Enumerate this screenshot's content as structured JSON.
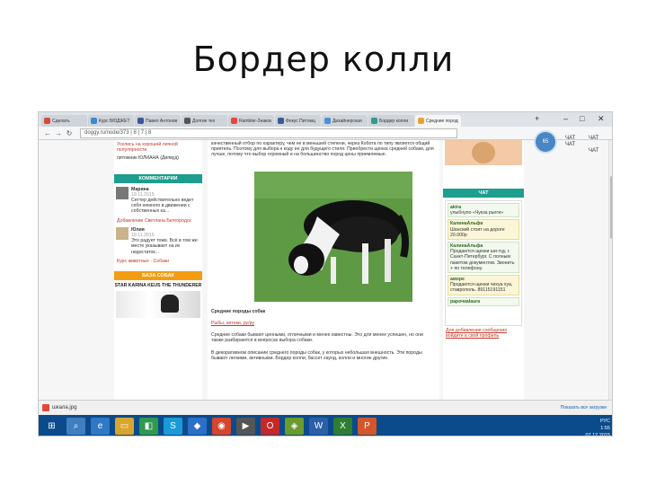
{
  "slide": {
    "title": "Бордер колли"
  },
  "browser": {
    "tabs": [
      {
        "label": "Сделать",
        "color": "#d64a3b",
        "active": false
      },
      {
        "label": "Курс БЮДЖЕТ",
        "color": "#3a8ad6",
        "active": false
      },
      {
        "label": "Павел Антонов",
        "color": "#3b5998",
        "active": false
      },
      {
        "label": "Долгие тех",
        "color": "#555555",
        "active": false
      },
      {
        "label": "Rambler-Знаком",
        "color": "#e8453c",
        "active": false
      },
      {
        "label": "Фокус Питомц",
        "color": "#3b5998",
        "active": false
      },
      {
        "label": "Дизайнерская",
        "color": "#4a90d9",
        "active": false
      },
      {
        "label": "Бордер колли",
        "color": "#2e9c8a",
        "active": false
      },
      {
        "label": "Средние породы",
        "color": "#f0a030",
        "active": true
      }
    ],
    "url": "doggy.ru/node/373 | 8 | 7 | 8",
    "extension": {
      "badge": "65",
      "labels": [
        "ЧАТ",
        "ЧАТ",
        "ЧАТ",
        "ЧАТ"
      ]
    }
  },
  "left_column": {
    "top_link": "Уселись на хорошей личной популярности",
    "top_author": "питомник ЮЛИАНА (Дипвуд)",
    "comments_title": "КОММЕНТАРИИ",
    "comments": [
      {
        "name": "Марина",
        "date": "19.11.2015",
        "text": "Сеттер действительно ведет себя немного в движении с собственных ка...",
        "link": "Добавление Светлана Белгородск"
      },
      {
        "name": "Юлия",
        "date": "19.11.2015",
        "text": "Это радует тоже. Всё в том же месте указывает на их недостаток...",
        "link": "Курс животных - Собаки"
      }
    ],
    "promo_title": "БАЗА СОБАК",
    "promo_text": "STAR KARINA KEUS THE THUNDERER"
  },
  "center": {
    "intro_text": "качественный отбор по характеру, чем не в меньшей степени, через Кобота по типу является общий приятель. Поэтому для выбора к коду ее для будущего стиля. Приобрести щенка средней собаки, для лучше, потому что выбор огромный и на большинство пород цены приемлемые.",
    "section_heading": "Средние породы собак",
    "section_link": "Рыбы, аптеки, ру/ру",
    "para1": "Средние собаки бывают ценными, отличными и менее известны. Это для менее успешен, но они также разбираются в вопросах выбора собаки.",
    "para2": "В декоративном описании среднего породы собак, у которых небольшая внешность. Эти породы бывают легкими, активными. Бордер колли, бассет хаунд, колли и многие другие."
  },
  "right_column": {
    "chat_title": "ЧАТ",
    "messages": [
      {
        "name": "akira",
        "text": "улыбнуло «Чукза рыгги»",
        "style": "green"
      },
      {
        "name": "КалинаАльфа",
        "text": "Шанский стоит на дороге 20.000р",
        "style": "yellow"
      },
      {
        "name": "КалинаАльфа",
        "text": "Продаются щенки ши-тцу, г. Санкт-Петербург. С полным пакетом документов. Звонить + по телефону.",
        "style": "green"
      },
      {
        "name": "аморе",
        "text": "Продаются щенки чихуа хуа, ставрополь. 89115191151",
        "style": "yellow"
      },
      {
        "name": "рарочкаlaura",
        "text": "",
        "style": "green"
      }
    ],
    "footer_link": "Для добавления сообщения войдите в свой профиль"
  },
  "download_bar": {
    "file": "шкала.jpg",
    "show_all": "Показать все загрузки"
  },
  "taskbar": {
    "apps": [
      {
        "icon": "search-icon",
        "color": "#3f7fbf"
      },
      {
        "icon": "ie-icon",
        "color": "#2e78c4"
      },
      {
        "icon": "folder-icon",
        "color": "#d9a52e"
      },
      {
        "icon": "store-icon",
        "color": "#2e9a4e"
      },
      {
        "icon": "skype-icon",
        "color": "#1a9ad6"
      },
      {
        "icon": "dropbox-icon",
        "color": "#2a6fc8"
      },
      {
        "icon": "chrome-icon",
        "color": "#d6452c"
      },
      {
        "icon": "media-icon",
        "color": "#555"
      },
      {
        "icon": "opera-icon",
        "color": "#c62828"
      },
      {
        "icon": "photo-icon",
        "color": "#6a9b2e"
      },
      {
        "icon": "word-icon",
        "color": "#2b5fa8"
      },
      {
        "icon": "excel-icon",
        "color": "#2e7d32"
      },
      {
        "icon": "powerpoint-icon",
        "color": "#d4572c"
      }
    ],
    "tray": {
      "lang": "РУС",
      "time": "1:55",
      "date": "07.12.2015"
    }
  }
}
